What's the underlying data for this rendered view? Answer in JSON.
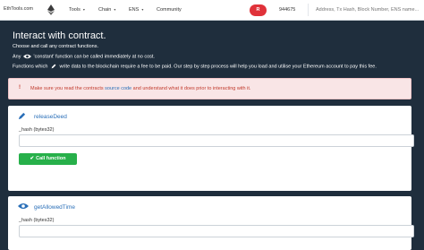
{
  "nav": {
    "brand": "EthTools.com",
    "items": [
      {
        "label": "Tools",
        "caret": "▾"
      },
      {
        "label": "Chain",
        "caret": "▾"
      },
      {
        "label": "ENS",
        "caret": "▾"
      },
      {
        "label": "Community"
      }
    ],
    "user_initial": "R",
    "block_number": "944675",
    "search_placeholder": "Address, Tx Hash, Block Number, ENS name..."
  },
  "page": {
    "title": "Interact with contract.",
    "subtitle": "Choose and call any contract functions.",
    "const_prefix": "Any",
    "const_suffix": "'constant' function can be called immediately at no cost.",
    "write_prefix": "Functions which",
    "write_suffix": "write data to the blockchain require a fee to be paid. Our step by step process will help you load and utilise your Ethereum account to pay this fee."
  },
  "alert": {
    "icon": "!",
    "before": "Make sure you read the contracts",
    "link": "source code",
    "after": "and understand what it does prior to interacting with it."
  },
  "functions": [
    {
      "name": "releaseDeed",
      "icon": "pencil-icon",
      "param_label": "_hash (bytes32)",
      "button": "Call function",
      "check": "✔"
    },
    {
      "name": "getAllowedTime",
      "icon": "eye-icon",
      "param_label": "_hash (bytes32)"
    }
  ],
  "colors": {
    "background": "#1f2e3d",
    "accent_red": "#e0323a",
    "link_blue": "#2a6fb8",
    "button_green": "#27b04a",
    "alert_bg": "#f9e5e6"
  }
}
